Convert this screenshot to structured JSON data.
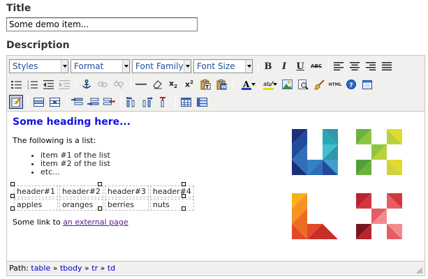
{
  "form": {
    "title_label": "Title",
    "title_value": "Some demo item...",
    "description_label": "Description"
  },
  "toolbar": {
    "styles": "Styles",
    "format": "Format",
    "font_family": "Font Family",
    "font_size": "Font Size",
    "bold": "B",
    "italic": "I",
    "underline": "U",
    "strike": "ABC",
    "html": "HTML"
  },
  "content": {
    "heading": "Some heading here...",
    "intro": "The following is a list:",
    "list": [
      "item #1 of the list",
      "item #2 of the list",
      "etc..."
    ],
    "table_headers": [
      "header#1",
      "header#2",
      "header#3",
      "header#4"
    ],
    "table_row": [
      "apples",
      "oranges",
      "berries",
      "nuts"
    ],
    "link_prefix": "Some link to ",
    "link_text": "an external page"
  },
  "status": {
    "path_label": "Path:",
    "path": [
      "table",
      "tbody",
      "tr",
      "td"
    ],
    "sep": "»"
  },
  "logo_colors": {
    "blue": [
      "#1b2f77",
      "#244a9a",
      "#2f6fb7",
      "#3fa0cf",
      "#2e98a8"
    ],
    "green": [
      "#69b33c",
      "#8cc63f",
      "#b7d23b",
      "#e4d92f",
      "#c6c6c6"
    ],
    "orange": [
      "#f7b21a",
      "#f59422",
      "#ee6b26",
      "#e3482a",
      "#c92d27"
    ],
    "red": [
      "#b8232f",
      "#d1373e",
      "#e75c62",
      "#f28b8d",
      "#7a1520"
    ]
  }
}
